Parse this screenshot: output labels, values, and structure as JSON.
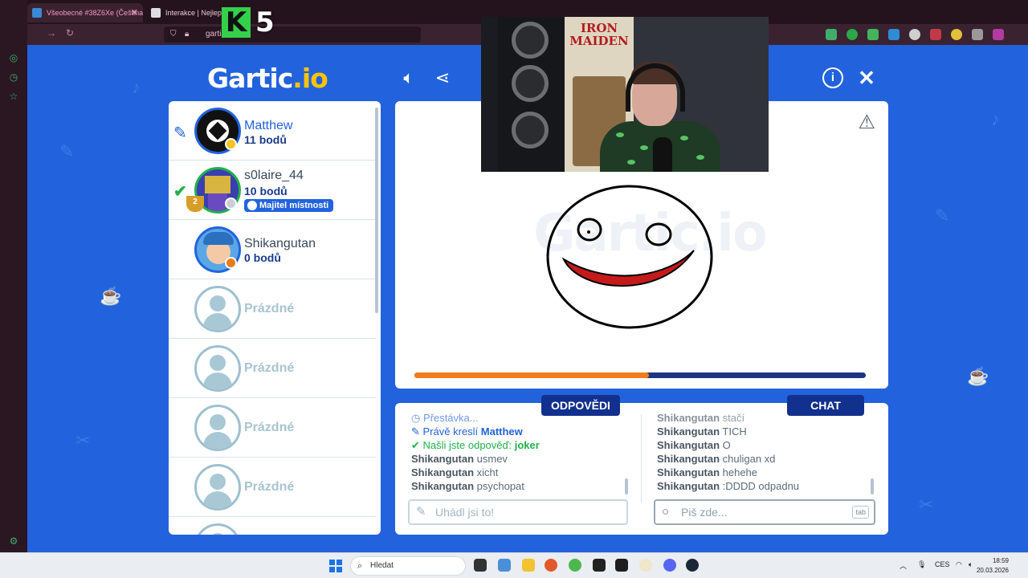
{
  "browser": {
    "tabs": [
      {
        "label": "Všeobecné #38Z6Xe (Čeština) ·",
        "active": true
      },
      {
        "label": "Interakce | Nejlep",
        "active": false
      }
    ],
    "url": "gartic.io"
  },
  "stream_overlay": {
    "counter_letter": "K",
    "counter_value": "5",
    "webcam_poster_text": "IRON MAIDEN"
  },
  "game": {
    "logo_main": "Gartic",
    "logo_suffix": ".io",
    "watermark": "Gartic.io",
    "players": [
      {
        "name": "Matthew",
        "points": "11 bodů",
        "status": "drawing",
        "status_color": "#f7c21d"
      },
      {
        "name": "s0laire_44",
        "points": "10 bodů",
        "status": "guessed",
        "badge": "Majitel místnosti",
        "rank": "2",
        "status_color": "#c9ced6"
      },
      {
        "name": "Shikangutan",
        "points": "0 bodů",
        "status": "none",
        "status_color": "#ea7d1b"
      },
      {
        "name": "Prázdné"
      },
      {
        "name": "Prázdné"
      },
      {
        "name": "Prázdné"
      },
      {
        "name": "Prázdné"
      }
    ],
    "timer_progress": 0.52,
    "answers_tab": "ODPOVĚDI",
    "chat_tab": "CHAT",
    "answers": [
      {
        "type": "sys",
        "text": "Přestávka..."
      },
      {
        "type": "sys",
        "prefix": "Právě kreslí ",
        "bold": "Matthew"
      },
      {
        "type": "ok",
        "prefix": "Našli jste odpověď: ",
        "bold": "joker"
      },
      {
        "type": "user",
        "user": "Shikangutan",
        "text": "usmev"
      },
      {
        "type": "user",
        "user": "Shikangutan",
        "text": "xicht"
      },
      {
        "type": "user",
        "user": "Shikangutan",
        "text": "psychopat"
      }
    ],
    "chat": [
      {
        "user": "Shikangutan",
        "text": "stačí"
      },
      {
        "user": "Shikangutan",
        "text": "TICH"
      },
      {
        "user": "Shikangutan",
        "text": "O"
      },
      {
        "user": "Shikangutan",
        "text": "chuligan xd"
      },
      {
        "user": "Shikangutan",
        "text": "hehehe"
      },
      {
        "user": "Shikangutan",
        "text": ":DDDD odpadnu"
      }
    ],
    "answer_placeholder": "Uhádl jsi to!",
    "chat_placeholder": "Piš zde...",
    "chat_key_hint": "tab",
    "colors": {
      "background": "#2263dd",
      "accent_dark": "#12308d",
      "progress": "#ef7d1e",
      "correct": "#21b14a"
    }
  },
  "taskbar": {
    "search_placeholder": "Hledat",
    "language": "CES",
    "time": "18:59",
    "date": "20.03.2026"
  }
}
